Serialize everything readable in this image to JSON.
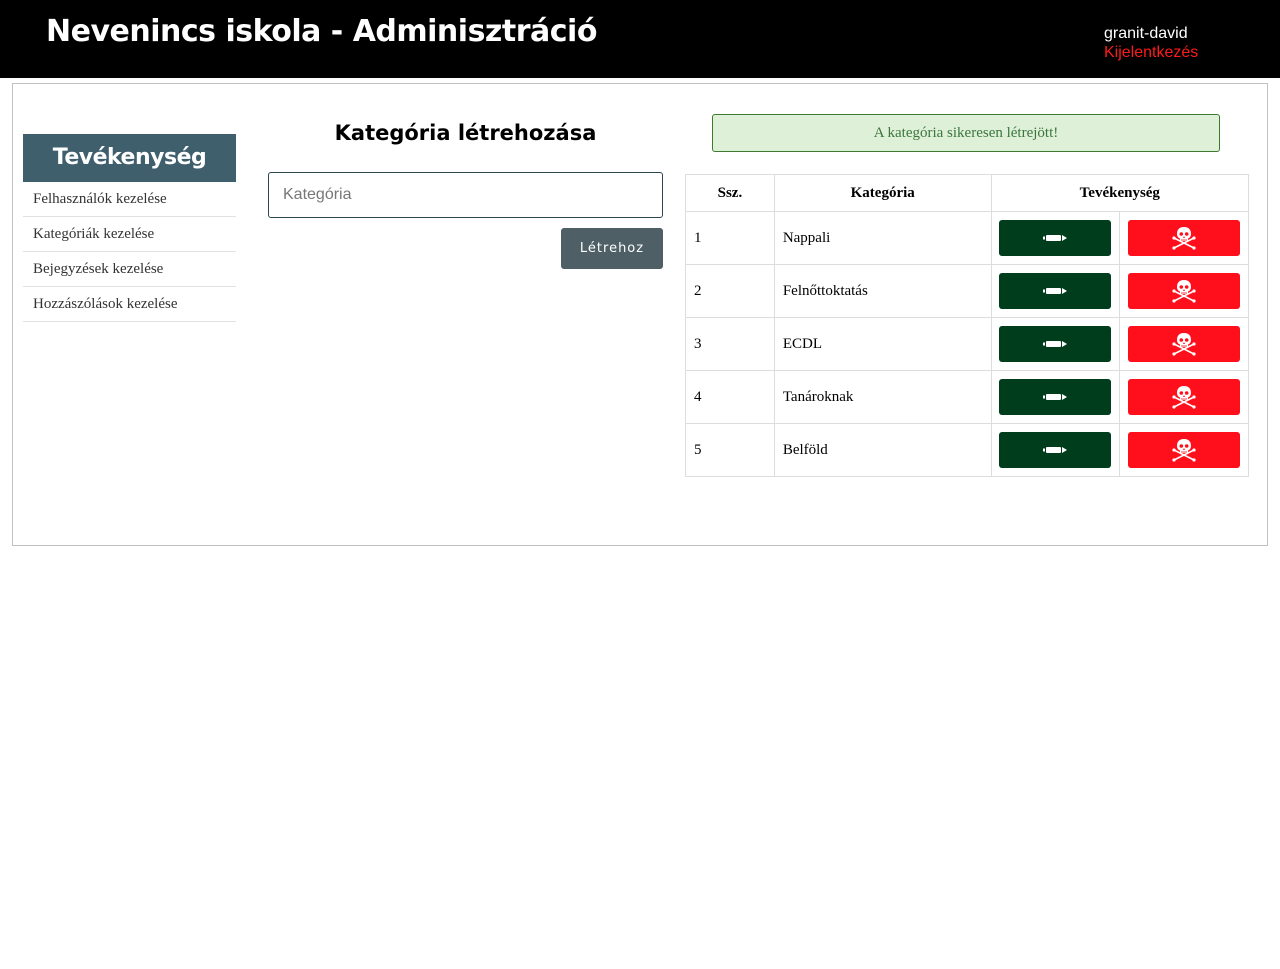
{
  "header": {
    "title": "Nevenincs iskola - Adminisztráció",
    "username": "granit-david",
    "logout_label": "Kijelentkezés"
  },
  "sidebar": {
    "title": "Tevékenység",
    "items": [
      {
        "label": "Felhasználók kezelése"
      },
      {
        "label": "Kategóriák kezelése"
      },
      {
        "label": "Bejegyzések kezelése"
      },
      {
        "label": "Hozzászólások kezelése"
      }
    ]
  },
  "form": {
    "title": "Kategória létrehozása",
    "input_placeholder": "Kategória",
    "input_value": "",
    "submit_label": "Létrehoz"
  },
  "alert": {
    "message": "A kategória sikeresen létrejött!"
  },
  "table": {
    "headers": {
      "num": "Ssz.",
      "category": "Kategória",
      "actions": "Tevékenység"
    },
    "rows": [
      {
        "num": "1",
        "category": "Nappali"
      },
      {
        "num": "2",
        "category": "Felnőttoktatás"
      },
      {
        "num": "3",
        "category": "ECDL"
      },
      {
        "num": "4",
        "category": "Tanároknak"
      },
      {
        "num": "5",
        "category": "Belföld"
      }
    ],
    "edit_icon": "pencil-icon",
    "delete_icon": "skull-crossbones-icon"
  },
  "colors": {
    "topbar": "#000000",
    "logout": "#ff1a1a",
    "sidebar_header": "#3f5f6d",
    "create_button": "#4e5f66",
    "edit_button": "#003d1c",
    "delete_button": "#ff0f1c",
    "alert_bg": "#def0d8",
    "alert_text": "#3c763d"
  }
}
